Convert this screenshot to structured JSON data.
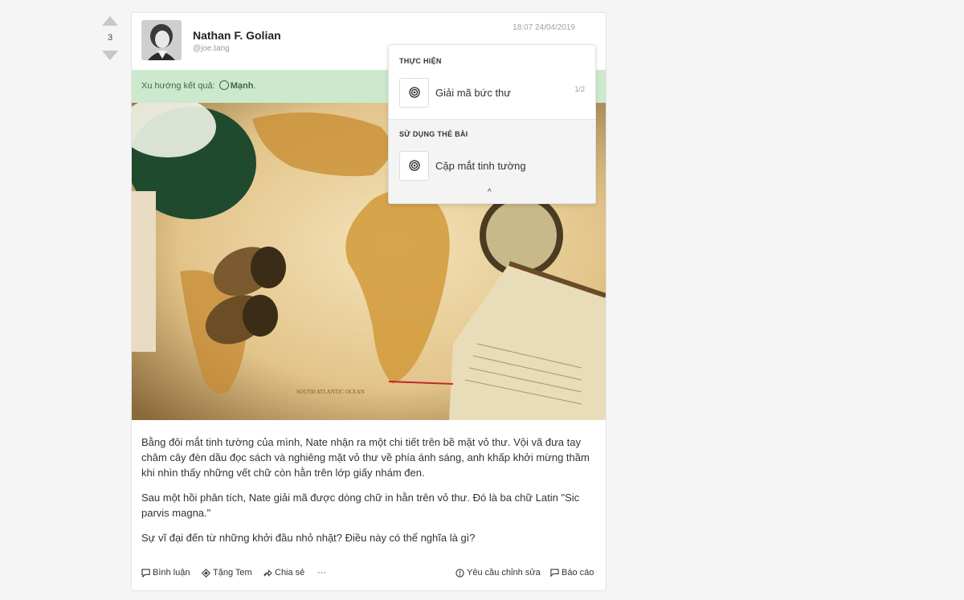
{
  "post": {
    "votes": "3",
    "author_name": "Nathan F. Golian",
    "author_handle": "@joe.tang",
    "timestamp": "18:07 24/04/2019",
    "trend_prefix": "Xu hướng kết quả:",
    "trend_value": "Mạnh",
    "trend_suffix": ".",
    "paragraphs": [
      "Bằng đôi mắt tinh tường của mình, Nate nhận ra một chi tiết trên bề mặt vỏ thư. Vội vã đưa tay châm cây đèn dầu đọc sách và nghiêng mặt vỏ thư về phía ánh sáng, anh khấp khởi mừng thầm khi nhìn thấy những vết chữ còn hằn trên lớp giấy nhám đen.",
      "Sau một hồi phân tích, Nate giải mã được dòng chữ in hằn trên vỏ thư. Đó là ba chữ Latin \"Sic parvis magna.\"",
      "Sự vĩ đại đến từ những khởi đầu nhỏ nhặt? Điều này có thể nghĩa là gì?"
    ],
    "photo_map_label": "SOUTH ATLANTIC OCEAN"
  },
  "actions": {
    "comment": "Bình luận",
    "gift": "Tặng Tem",
    "share": "Chia sẻ",
    "more": "···",
    "request_edit": "Yêu cầu chỉnh sửa",
    "report": "Báo cáo"
  },
  "dropdown": {
    "section1_title": "THỰC HIỆN",
    "item1_label": "Giải mã bức thư",
    "item1_count": "1/2",
    "section2_title": "SỬ DỤNG THẺ BÀI",
    "item2_label": "Cặp mắt tinh tường",
    "collapse": "^"
  },
  "colors": {
    "trend_bg": "#cde9cd",
    "trend_text": "#3f6b3f"
  }
}
